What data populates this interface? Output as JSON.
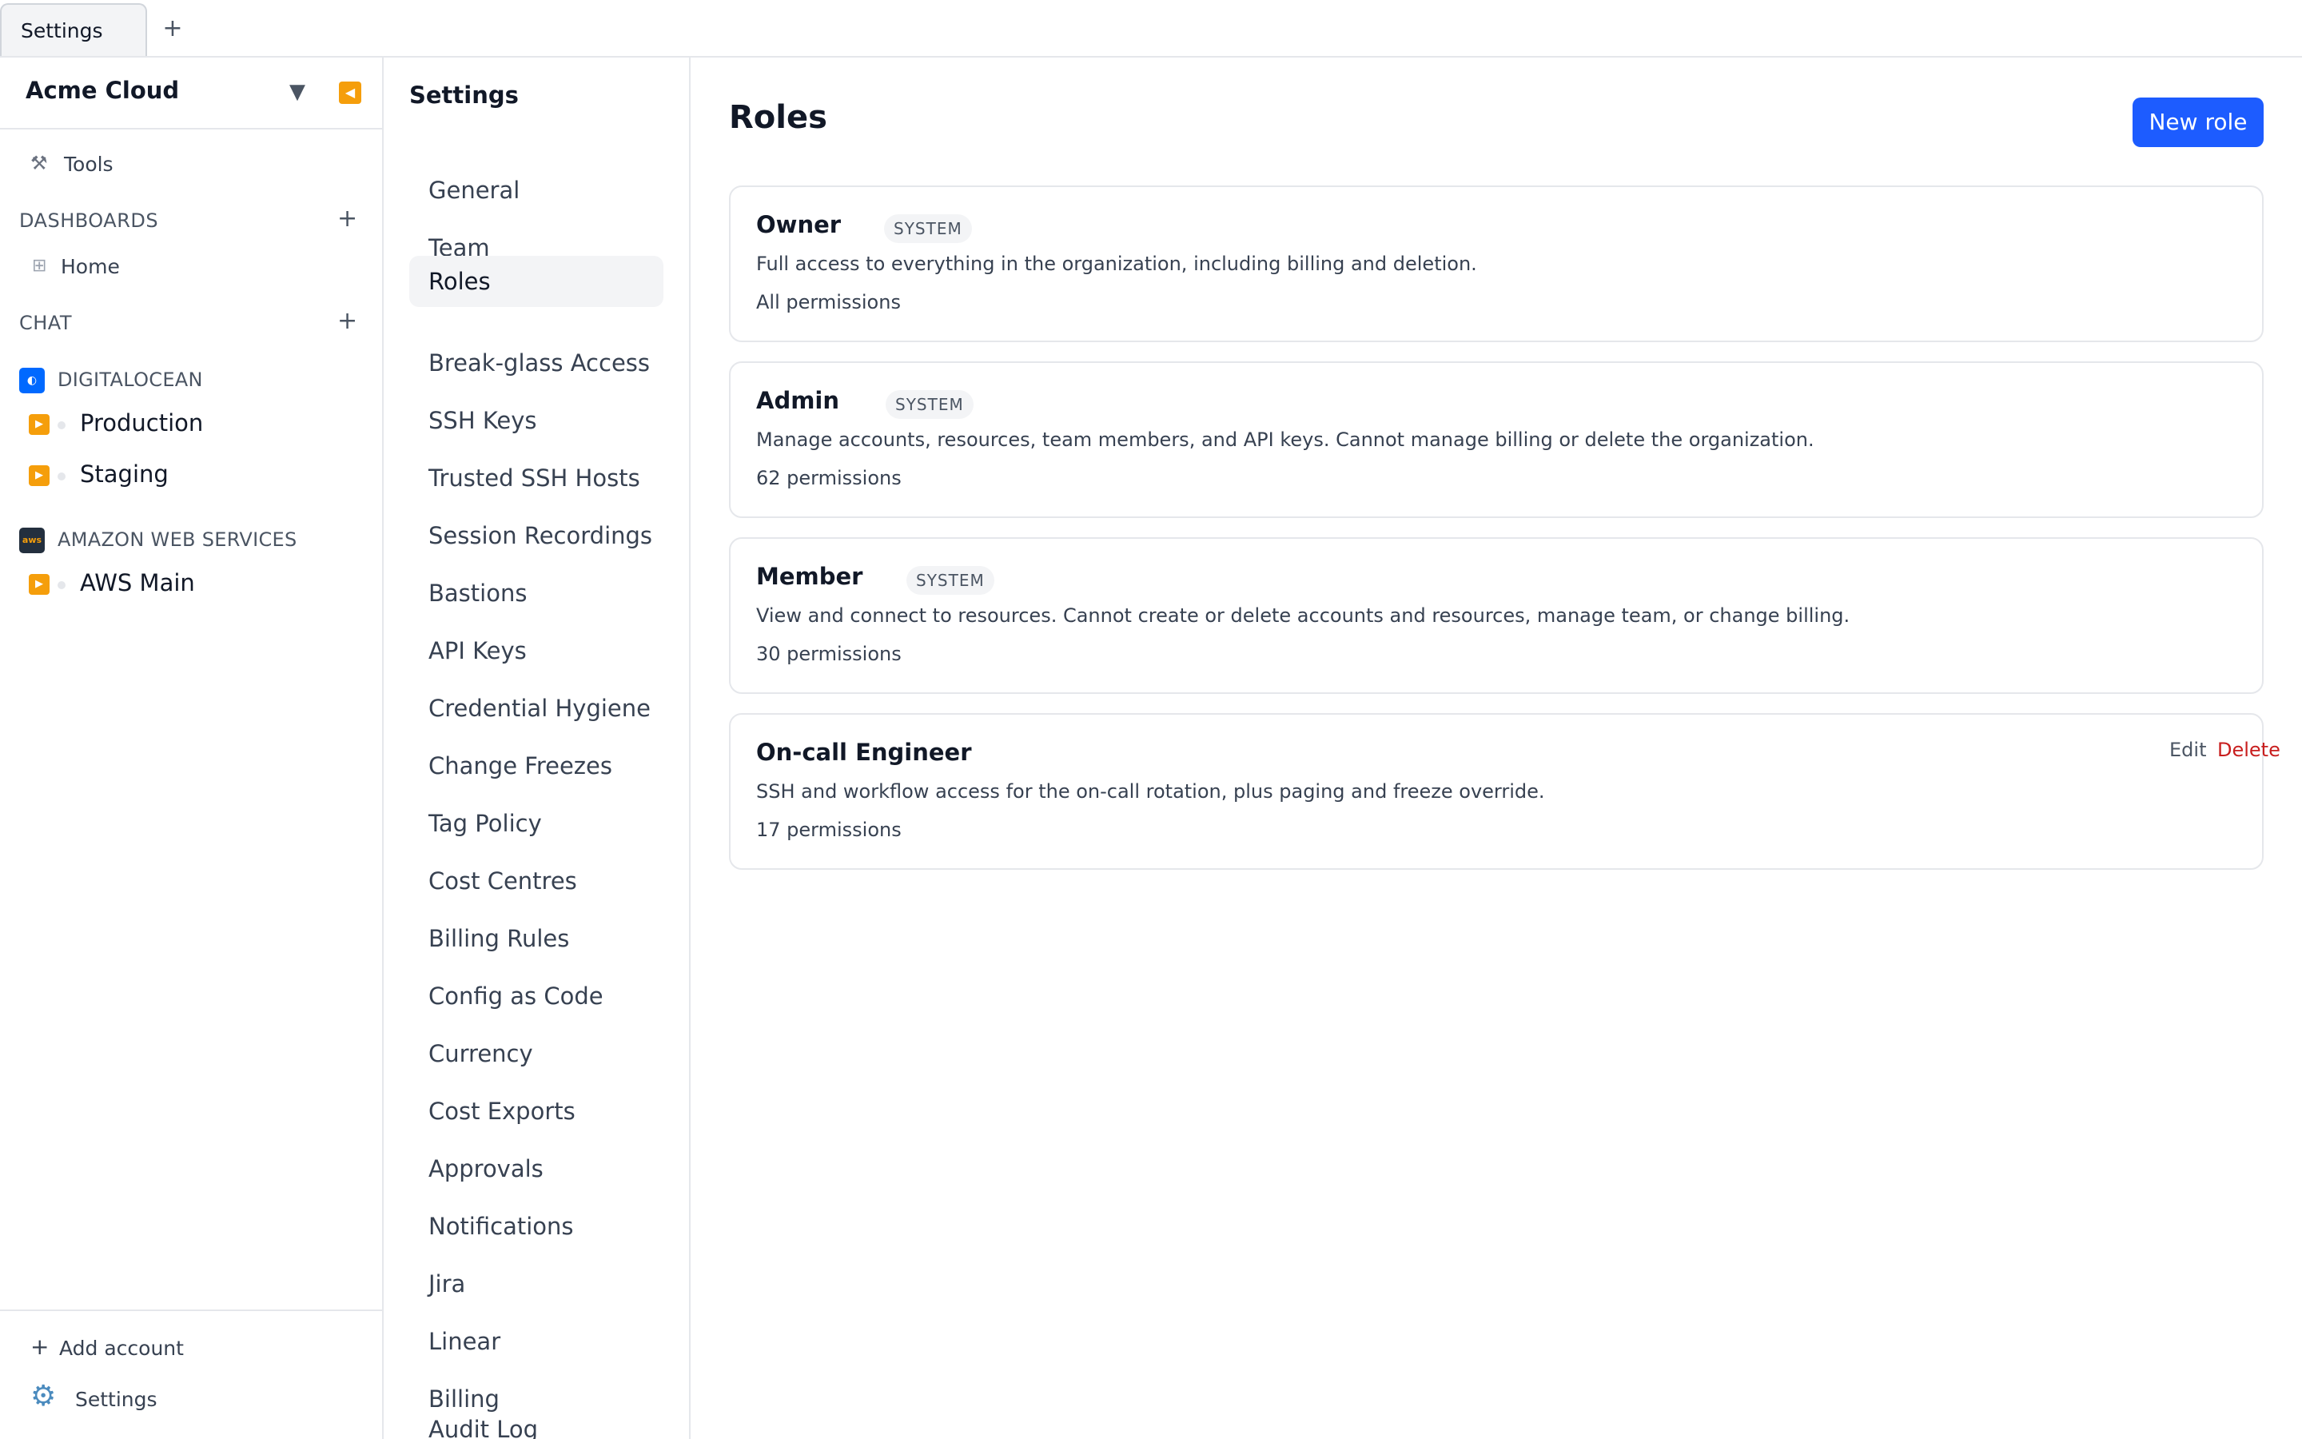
{
  "tabbar": {
    "tabs": [
      {
        "label": "Settings"
      }
    ],
    "add_label": "+"
  },
  "sidebar": {
    "org_name": "Acme Cloud",
    "tools_label": "Tools",
    "dashboards": {
      "heading": "DASHBOARDS",
      "items": [
        {
          "label": "Home"
        }
      ]
    },
    "chat": {
      "heading": "CHAT"
    },
    "providers": [
      {
        "name": "DIGITALOCEAN",
        "accounts": [
          {
            "label": "Production"
          },
          {
            "label": "Staging"
          }
        ]
      },
      {
        "name": "AMAZON WEB SERVICES",
        "accounts": [
          {
            "label": "AWS Main"
          }
        ]
      }
    ],
    "footer": {
      "add_account": "Add account",
      "settings": "Settings"
    }
  },
  "settings_nav": {
    "title": "Settings",
    "items": [
      {
        "label": "General"
      },
      {
        "label": "Team"
      },
      {
        "label": "Roles",
        "active": true
      },
      {
        "label": "Break-glass Access"
      },
      {
        "label": "SSH Keys"
      },
      {
        "label": "Trusted SSH Hosts"
      },
      {
        "label": "Session Recordings"
      },
      {
        "label": "Bastions"
      },
      {
        "label": "API Keys"
      },
      {
        "label": "Credential Hygiene"
      },
      {
        "label": "Change Freezes"
      },
      {
        "label": "Tag Policy"
      },
      {
        "label": "Cost Centres"
      },
      {
        "label": "Billing Rules"
      },
      {
        "label": "Config as Code"
      },
      {
        "label": "Currency"
      },
      {
        "label": "Cost Exports"
      },
      {
        "label": "Approvals"
      },
      {
        "label": "Notifications"
      },
      {
        "label": "Jira"
      },
      {
        "label": "Linear"
      },
      {
        "label": "Billing"
      },
      {
        "label": "Audit Log"
      }
    ]
  },
  "main": {
    "title": "Roles",
    "new_role_label": "New role",
    "roles": [
      {
        "name": "Owner",
        "badge": "SYSTEM",
        "description": "Full access to everything in the organization, including billing and deletion.",
        "permissions": "All permissions"
      },
      {
        "name": "Admin",
        "badge": "SYSTEM",
        "description": "Manage accounts, resources, team members, and API keys. Cannot manage billing or delete the organization.",
        "permissions": "62 permissions"
      },
      {
        "name": "Member",
        "badge": "SYSTEM",
        "description": "View and connect to resources. Cannot create or delete accounts and resources, manage team, or change billing.",
        "permissions": "30 permissions"
      },
      {
        "name": "On-call Engineer",
        "description": "SSH and workflow access for the on-call rotation, plus paging and freeze override.",
        "permissions": "17 permissions",
        "edit_label": "Edit",
        "delete_label": "Delete"
      }
    ]
  },
  "colors": {
    "accent": "#1d5cff",
    "danger": "#c81e1e",
    "account_icon": "#f59e0b",
    "digitalocean": "#0069ff",
    "aws": "#232f3e"
  },
  "icons": {
    "tools": "wrench-icon",
    "home": "grid-icon",
    "digitalocean": "digitalocean-logo-icon",
    "aws": "aws-logo-icon",
    "account": "terminal-icon",
    "add_account": "plus-icon",
    "settings": "gear-icon"
  }
}
